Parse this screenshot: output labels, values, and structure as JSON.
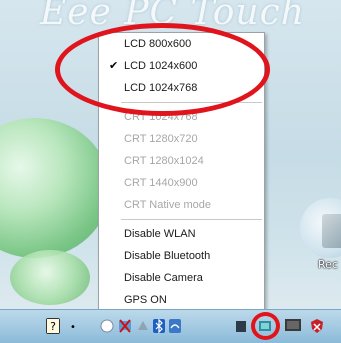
{
  "desktop": {
    "brand_text": "Eee PC Touch",
    "icon_label": "Rec"
  },
  "menu": {
    "lcd": [
      {
        "label": "LCD 800x600",
        "checked": false
      },
      {
        "label": "LCD 1024x600",
        "checked": true
      },
      {
        "label": "LCD 1024x768",
        "checked": false
      }
    ],
    "crt": [
      {
        "label": "CRT 1024x768"
      },
      {
        "label": "CRT 1280x720"
      },
      {
        "label": "CRT 1280x1024"
      },
      {
        "label": "CRT 1440x900"
      },
      {
        "label": "CRT Native mode"
      }
    ],
    "toggles": [
      {
        "label": "Disable WLAN"
      },
      {
        "label": "Disable Bluetooth"
      },
      {
        "label": "Disable Camera"
      },
      {
        "label": "GPS ON"
      }
    ],
    "check_mark": "✔"
  },
  "taskbar": {
    "tray_icons": [
      "help-icon",
      "chevron-icon",
      "security-icon",
      "network-icon",
      "device-icon",
      "bluetooth-icon",
      "wlan-icon",
      "display-settings-icon",
      "monitor-icon",
      "shield-icon"
    ]
  },
  "colors": {
    "highlight": "#e0141c",
    "disabled_text": "#a7a7a7"
  }
}
